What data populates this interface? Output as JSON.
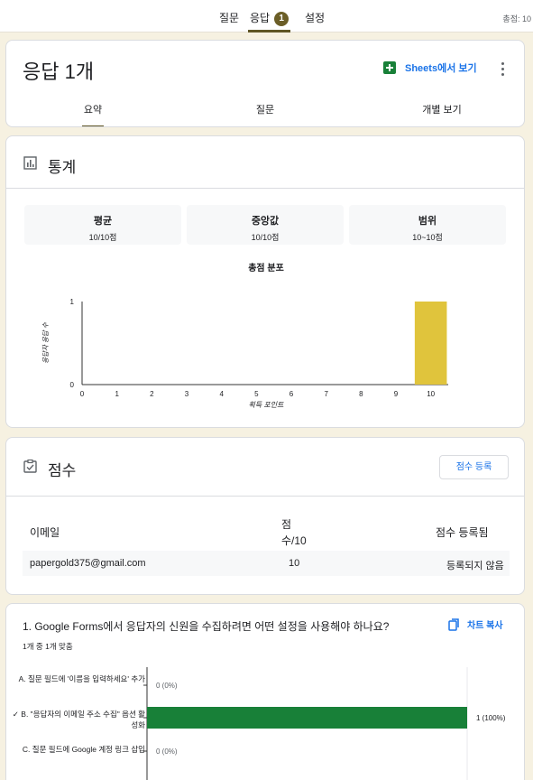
{
  "topbar": {
    "tabs": [
      {
        "label": "질문"
      },
      {
        "label": "응답",
        "badge": "1"
      },
      {
        "label": "설정"
      }
    ],
    "total_points": "총점: 10"
  },
  "header": {
    "title": "응답 1개",
    "sheets_label": "Sheets에서 보기",
    "tabs": [
      {
        "label": "요약"
      },
      {
        "label": "질문"
      },
      {
        "label": "개별 보기"
      }
    ]
  },
  "stats": {
    "title": "통계",
    "boxes": [
      {
        "label": "평균",
        "value": "10/10점"
      },
      {
        "label": "중앙값",
        "value": "10/10점"
      },
      {
        "label": "범위",
        "value": "10~10점"
      }
    ]
  },
  "chart_data": [
    {
      "type": "bar",
      "title": "총점 분포",
      "xlabel": "획득 포인트",
      "ylabel": "응답자 응답 수",
      "categories": [
        "0",
        "1",
        "2",
        "3",
        "4",
        "5",
        "6",
        "7",
        "8",
        "9",
        "10"
      ],
      "values": [
        0,
        0,
        0,
        0,
        0,
        0,
        0,
        0,
        0,
        0,
        1
      ],
      "ylim": [
        0,
        1
      ],
      "yticks": [
        "0",
        "1"
      ],
      "grid": false,
      "color": "#e0c43c"
    },
    {
      "type": "bar",
      "orientation": "horizontal",
      "categories": [
        "A. 질문 필드에 '이름을 입력하세요' 추가",
        "✓ B. \"응답자의 이메일 주소 수집\" 옵션 활성화",
        "C. 질문 필드에 Google 계정 링크 삽입"
      ],
      "values": [
        0,
        1,
        0
      ],
      "value_labels": [
        "0 (0%)",
        "1 (100%)",
        "0 (0%)"
      ],
      "color": "#188038"
    }
  ],
  "scores": {
    "title": "점수",
    "register_button": "점수 등록",
    "columns": [
      "이메일",
      "점\n수/10",
      "점수 등록됨"
    ],
    "rows": [
      {
        "email": "papergold375@gmail.com",
        "score": "10",
        "status": "등록되지 않음"
      }
    ]
  },
  "question1": {
    "title": "1. Google Forms에서 응답자의 신원을 수집하려면 어떤 설정을 사용해야 하나요?",
    "copy_label": "차트 복사",
    "correct_count": "1개 중 1개 맞춤"
  },
  "colors": {
    "accent": "#5f5524",
    "link": "#1a73e8",
    "bar_correct": "#188038",
    "bar_hist": "#e0c43c",
    "page_bg": "#f6f1e1"
  }
}
